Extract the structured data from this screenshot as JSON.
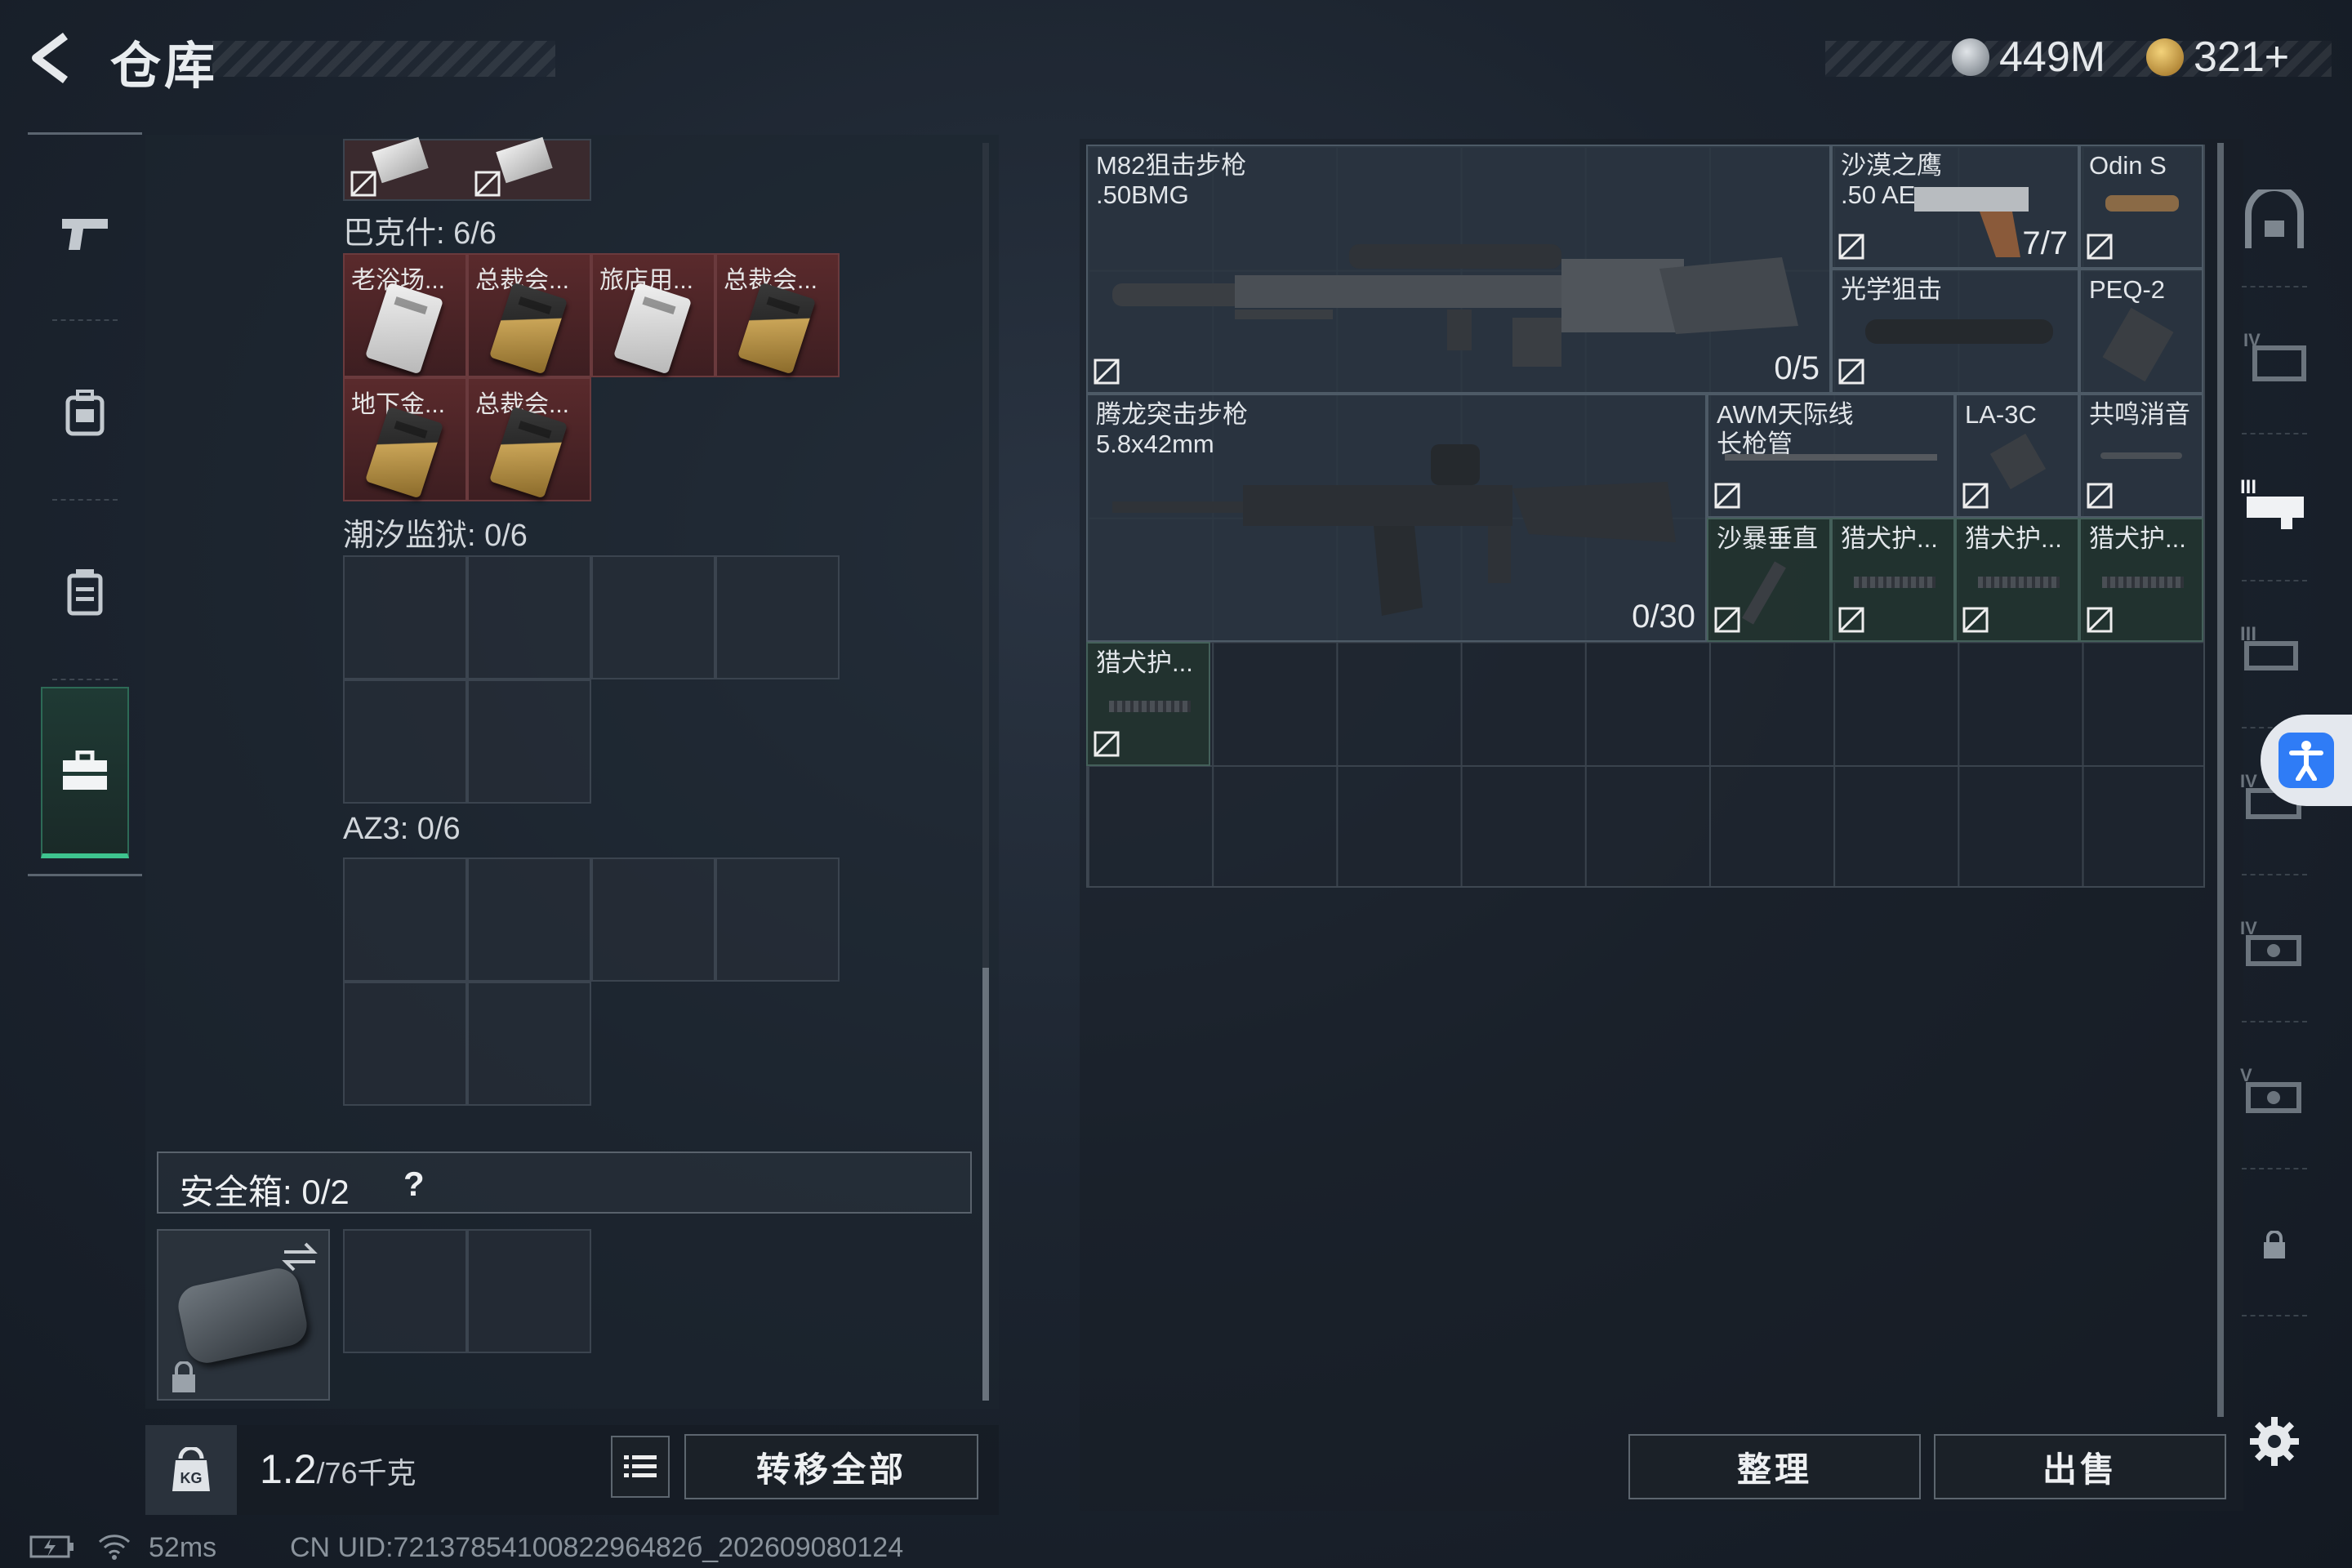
{
  "header": {
    "title": "仓库",
    "currency1": "449M",
    "currency2": "321+"
  },
  "left_sections": {
    "bakshi": {
      "label": "巴克什: 6/6",
      "cards": [
        "老浴场...",
        "总裁会...",
        "旅店用...",
        "总裁会...",
        "地下金...",
        "总裁会..."
      ]
    },
    "tide_prison": {
      "label": "潮汐监狱: 0/6"
    },
    "az3": {
      "label": "AZ3: 0/6"
    }
  },
  "safebox": {
    "label": "安全箱: 0/2",
    "help": "?"
  },
  "bottom_left": {
    "weight_main": "1.2",
    "weight_unit": "/76千克",
    "transfer_all": "转移全部"
  },
  "items": [
    {
      "name1": "M82狙击步枪",
      "name2": ".50BMG",
      "count": "0/5"
    },
    {
      "name1": "沙漠之鹰",
      "name2": ".50 AE",
      "count": "7/7"
    },
    {
      "name1": "Odin S"
    },
    {
      "name1": "光学狙击"
    },
    {
      "name1": "PEQ-2"
    },
    {
      "name1": "腾龙突击步枪",
      "name2": "5.8x42mm",
      "count": "0/30"
    },
    {
      "name1": "AWM天际线",
      "name2": "长枪管"
    },
    {
      "name1": "LA-3C"
    },
    {
      "name1": "共鸣消音"
    },
    {
      "name1": "沙暴垂直"
    },
    {
      "name1": "猎犬护..."
    },
    {
      "name1": "猎犬护..."
    },
    {
      "name1": "猎犬护..."
    },
    {
      "name1": "猎犬护..."
    }
  ],
  "bottom_right": {
    "sort": "整理",
    "sell": "出售"
  },
  "status": {
    "ping": "52ms",
    "uid": "CN UID:7213785410082296482б_202609080124"
  },
  "colors": {
    "accent_green": "#3ec48f",
    "card_red": "#5a2a2c",
    "access_blue": "#2f7cf6"
  }
}
